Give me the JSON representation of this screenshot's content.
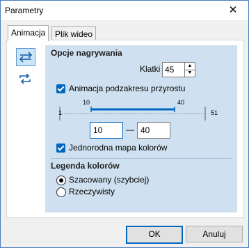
{
  "window": {
    "title": "Parametry",
    "close_label": "✕"
  },
  "tabs": [
    {
      "label": "Animacja"
    },
    {
      "label": "Plik wideo"
    }
  ],
  "sidebar": {
    "icons": [
      "transfer-arrows-icon",
      "repeat-icon"
    ]
  },
  "recording": {
    "heading": "Opcje nagrywania",
    "frames_label": "Klatki",
    "frames_value": "45",
    "subrange_label": "Animacja podzakresu przyrostu",
    "subrange_checked": true,
    "range_min": "1",
    "range_max": "51",
    "sel_start_tick": "10",
    "sel_end_tick": "40",
    "from_value": "10",
    "dash": "—",
    "to_value": "40",
    "uniform_label": "Jednorodna mapa kolorów",
    "uniform_checked": true
  },
  "legend": {
    "heading": "Legenda kolorów",
    "options": [
      "Szacowany (szybciej)",
      "Rzeczywisty"
    ],
    "selected": 0
  },
  "buttons": {
    "ok": "OK",
    "cancel": "Anuluj"
  },
  "colors": {
    "accent": "#0067c0",
    "content_bg": "#cfe1f0",
    "slider": "#0067c0"
  }
}
